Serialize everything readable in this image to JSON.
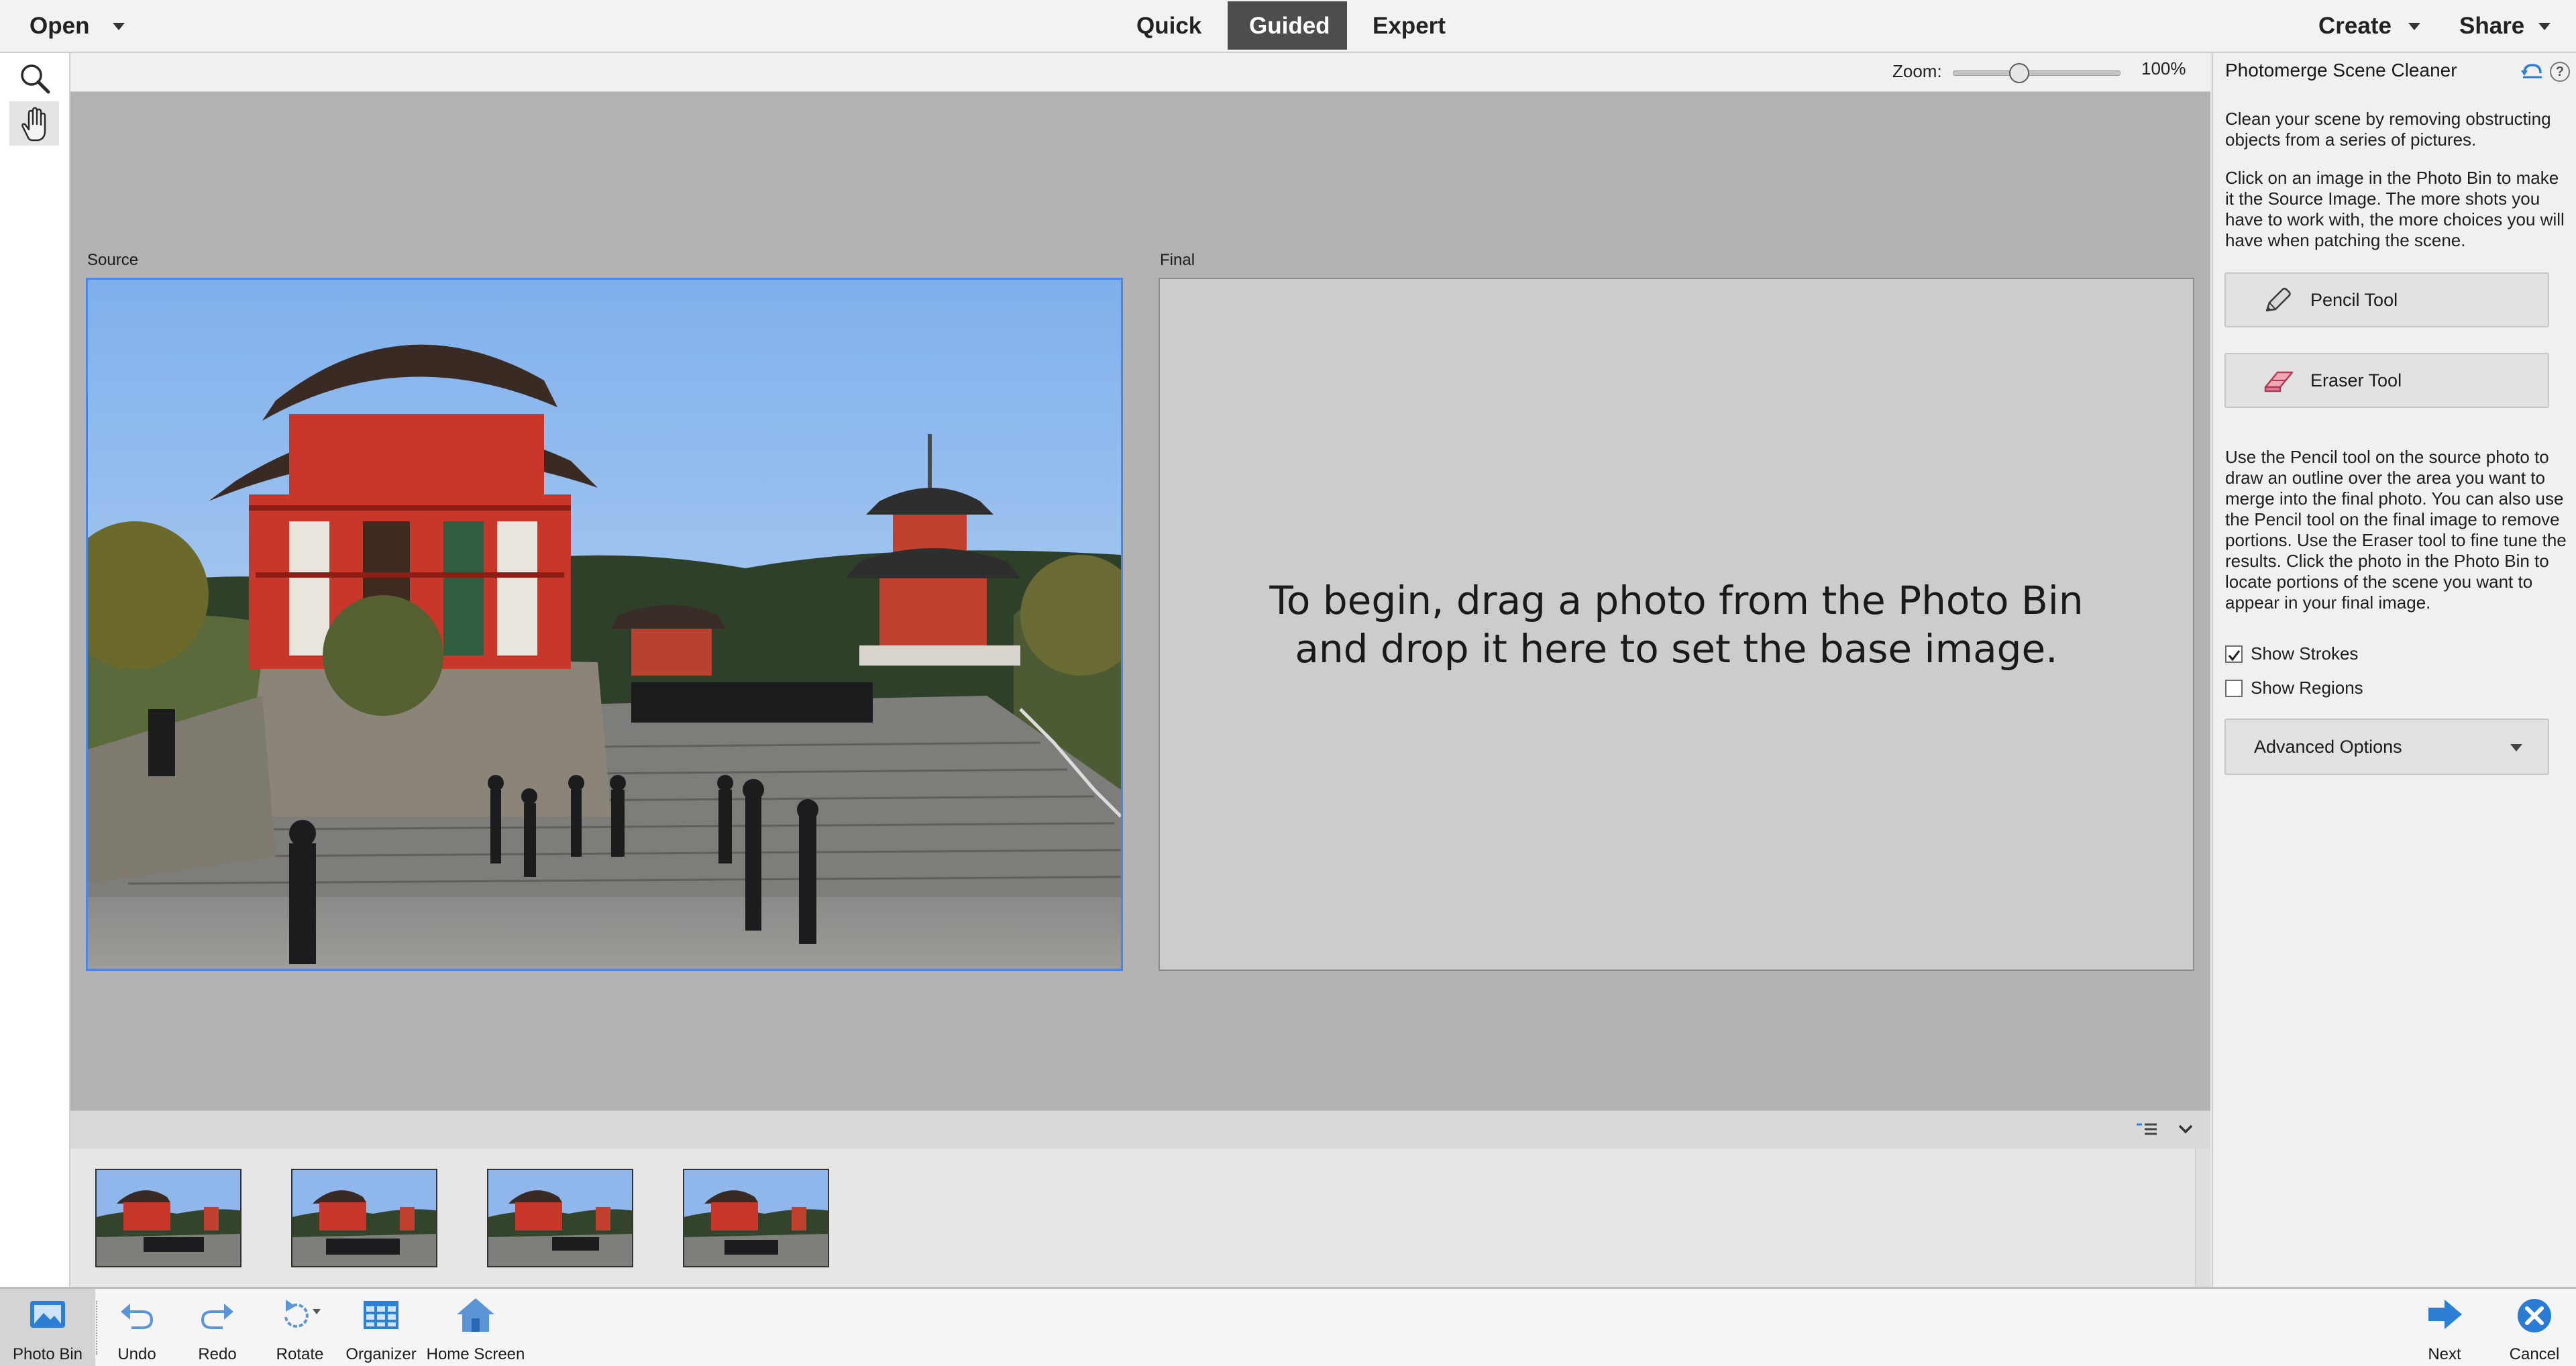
{
  "topbar": {
    "open_label": "Open",
    "modes": [
      "Quick",
      "Guided",
      "Expert"
    ],
    "active_mode": "Guided",
    "create_label": "Create",
    "share_label": "Share"
  },
  "toolbox": {
    "tools": [
      "zoom-tool",
      "hand-tool"
    ]
  },
  "zoom": {
    "label": "Zoom:",
    "value": "100%",
    "slider_level": 0.4
  },
  "canvas": {
    "source_label": "Source",
    "final_label": "Final",
    "final_instruction": "To begin, drag a photo from the Photo Bin\nand drop it here to set the base image."
  },
  "photo_bin": {
    "thumbnail_count": 4
  },
  "panel": {
    "title": "Photomerge Scene Cleaner",
    "intro": "Clean your scene by removing obstructing objects from a series of pictures.",
    "instructions": "Click on an image in the Photo Bin to make it the Source Image. The more shots you have to work with, the more choices you will have when patching the scene.",
    "pencil_label": "Pencil Tool",
    "eraser_label": "Eraser Tool",
    "help_text": "Use the Pencil tool on the source photo to draw an outline over the area you want to merge into the final photo. You can also use the Pencil tool on the final image to remove portions. Use the Eraser tool to fine tune the results. Click the photo in the Photo Bin to locate portions of the scene you want to appear in your final image.",
    "show_strokes_label": "Show Strokes",
    "show_strokes_checked": true,
    "show_regions_label": "Show Regions",
    "show_regions_checked": false,
    "advanced_label": "Advanced Options"
  },
  "taskbar": {
    "photo_bin": "Photo Bin",
    "undo": "Undo",
    "redo": "Redo",
    "rotate": "Rotate",
    "organizer": "Organizer",
    "home_screen": "Home Screen",
    "next": "Next",
    "cancel": "Cancel"
  },
  "colors": {
    "accent_blue": "#2d7fd3",
    "active_mode_bg": "#4d4d4d",
    "canvas_bg": "#b2b2b2",
    "cancel_blue": "#2a7bd4"
  }
}
